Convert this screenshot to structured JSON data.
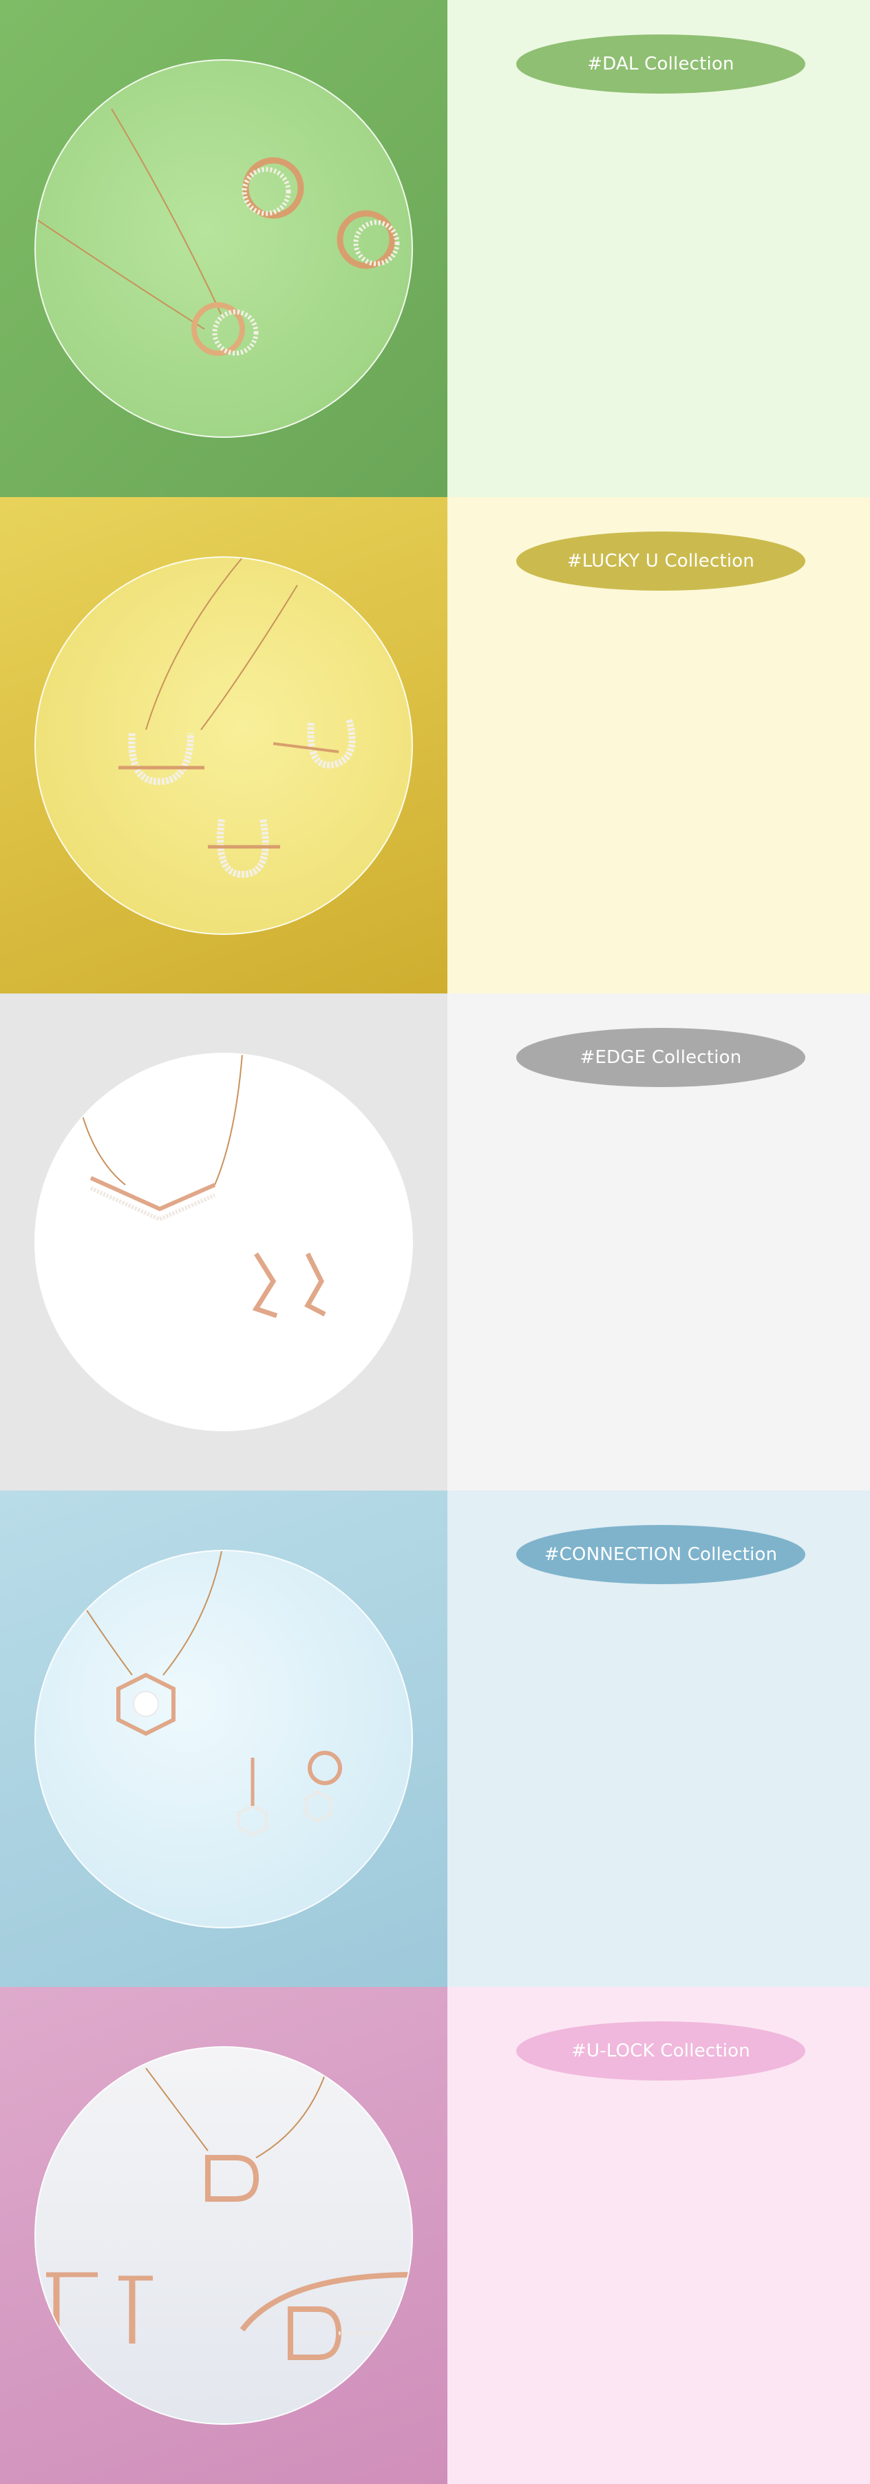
{
  "sections": [
    {
      "label": "#DAL Collection",
      "colors": {
        "left": "#74b05f",
        "circle": "#a8d98e",
        "right": "#ecf9e2",
        "badge": "#8fbf72"
      }
    },
    {
      "label": "#LUCKY U Collection",
      "colors": {
        "left": "#d9be3a",
        "circle": "#f2e684",
        "right": "#fdf8d8",
        "badge": "#cbbb4f"
      }
    },
    {
      "label": "#EDGE Collection",
      "colors": {
        "left": "#e6e6e6",
        "circle": "#ffffff",
        "right": "#f4f4f4",
        "badge": "#a9a9a9"
      }
    },
    {
      "label": "#CONNECTION Collection",
      "colors": {
        "left": "#a9d2e0",
        "circle": "#e2f4fb",
        "right": "#e2eff5",
        "badge": "#7fb3cc"
      }
    },
    {
      "label": "#U-LOCK Collection",
      "colors": {
        "left": "#d79bc2",
        "circle": "#f1f3f7",
        "right": "#fce6f3",
        "badge": "#f0b8dc"
      }
    }
  ]
}
